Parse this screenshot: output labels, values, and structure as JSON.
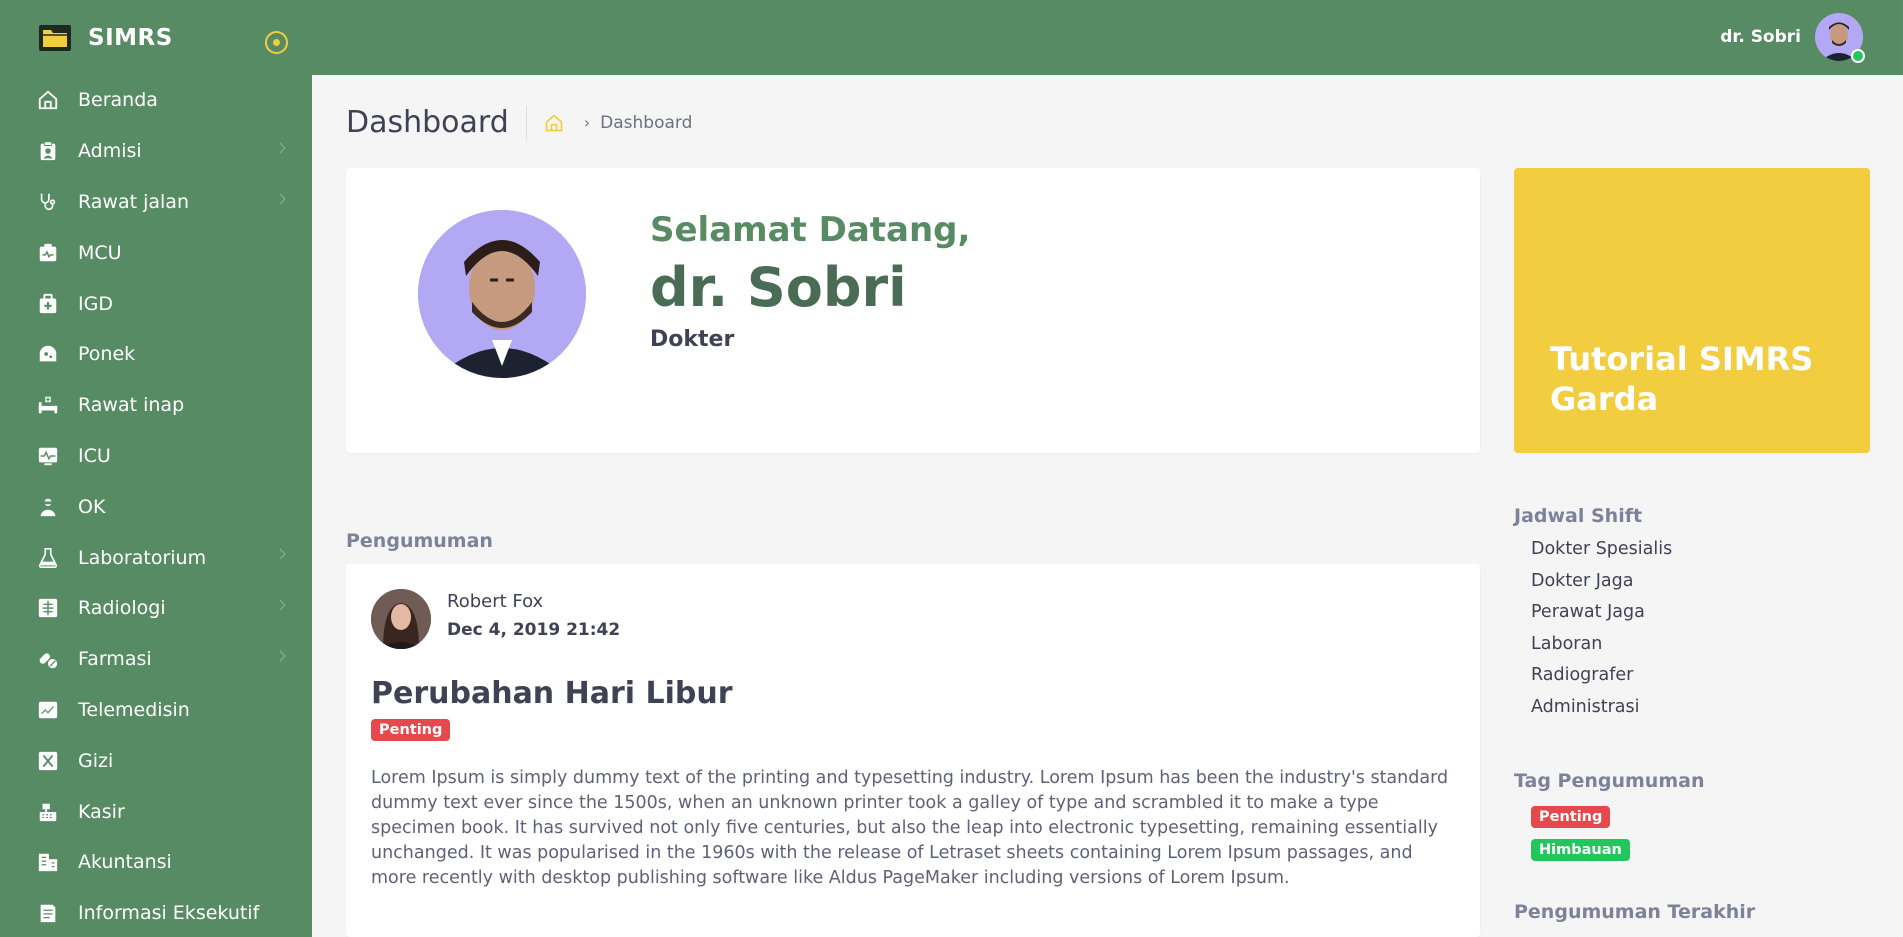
{
  "app": {
    "name": "SIMRS"
  },
  "sidebar": {
    "items": [
      {
        "label": "Beranda",
        "icon": "home-icon",
        "has_children": false
      },
      {
        "label": "Admisi",
        "icon": "clipboard-user-icon",
        "has_children": true
      },
      {
        "label": "Rawat jalan",
        "icon": "stethoscope-icon",
        "has_children": true
      },
      {
        "label": "MCU",
        "icon": "medical-checkup-icon",
        "has_children": false
      },
      {
        "label": "IGD",
        "icon": "first-aid-kit-icon",
        "has_children": false
      },
      {
        "label": "Ponek",
        "icon": "baby-care-icon",
        "has_children": false
      },
      {
        "label": "Rawat inap",
        "icon": "hospital-bed-icon",
        "has_children": false
      },
      {
        "label": "ICU",
        "icon": "heart-monitor-icon",
        "has_children": false
      },
      {
        "label": "OK",
        "icon": "surgeon-icon",
        "has_children": false
      },
      {
        "label": "Laboratorium",
        "icon": "flask-icon",
        "has_children": true
      },
      {
        "label": "Radiologi",
        "icon": "xray-icon",
        "has_children": true
      },
      {
        "label": "Farmasi",
        "icon": "pills-icon",
        "has_children": true
      },
      {
        "label": "Telemedisin",
        "icon": "telemedicine-icon",
        "has_children": false
      },
      {
        "label": "Gizi",
        "icon": "utensils-icon",
        "has_children": false
      },
      {
        "label": "Kasir",
        "icon": "cash-register-icon",
        "has_children": false
      },
      {
        "label": "Akuntansi",
        "icon": "accounting-icon",
        "has_children": false
      },
      {
        "label": "Informasi Eksekutif",
        "icon": "report-icon",
        "has_children": false
      }
    ]
  },
  "header": {
    "user_name": "dr. Sobri"
  },
  "page": {
    "title": "Dashboard",
    "breadcrumb": [
      "Dashboard"
    ]
  },
  "welcome": {
    "greeting": "Selamat Datang,",
    "name": "dr. Sobri",
    "role": "Dokter"
  },
  "tutorial": {
    "title": "Tutorial SIMRS Garda"
  },
  "announcements": {
    "section_label": "Pengumuman",
    "items": [
      {
        "author": "Robert Fox",
        "date": "Dec 4, 2019 21:42",
        "title": "Perubahan Hari Libur",
        "tag": "Penting",
        "body": "Lorem Ipsum is simply dummy text of the printing and typesetting industry. Lorem Ipsum has been the industry's standard dummy text ever since the 1500s, when an unknown printer took a galley of type and scrambled it to make a type specimen book. It has survived not only five centuries, but also the leap into electronic typesetting, remaining essentially unchanged. It was popularised in the 1960s with the release of Letraset sheets containing Lorem Ipsum passages, and more recently with desktop publishing software like Aldus PageMaker including versions of Lorem Ipsum."
      }
    ]
  },
  "jadwal_shift": {
    "title": "Jadwal Shift",
    "items": [
      "Dokter Spesialis",
      "Dokter Jaga",
      "Perawat Jaga",
      "Laboran",
      "Radiografer",
      "Administrasi"
    ]
  },
  "tags": {
    "title": "Tag Pengumuman",
    "items": [
      {
        "label": "Penting",
        "color": "#e5484d"
      },
      {
        "label": "Himbauan",
        "color": "#22c55e"
      }
    ]
  },
  "latest": {
    "title": "Pengumuman Terakhir"
  },
  "colors": {
    "primary": "#578b63",
    "accent": "#f2cd40",
    "danger": "#e5484d",
    "success": "#22c55e"
  }
}
